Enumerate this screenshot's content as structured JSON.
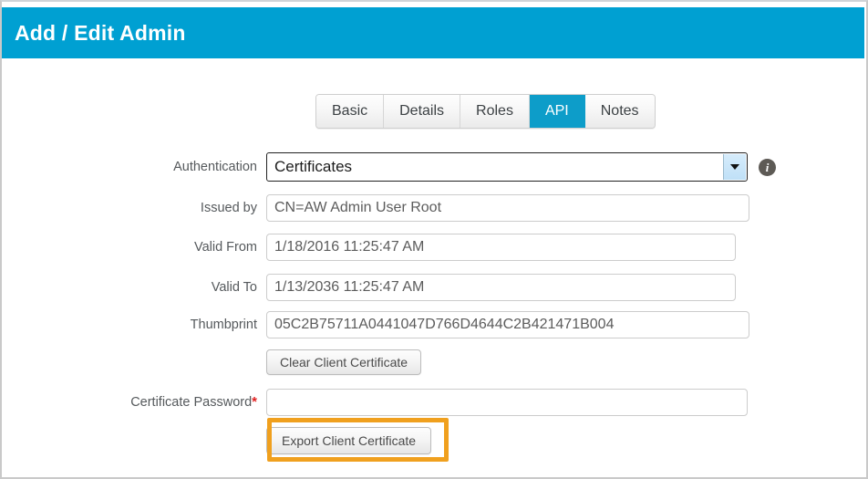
{
  "header": {
    "title": "Add / Edit Admin",
    "bg_color": "#00a0d2"
  },
  "tabs": [
    {
      "label": "Basic",
      "active": false
    },
    {
      "label": "Details",
      "active": false
    },
    {
      "label": "Roles",
      "active": false
    },
    {
      "label": "API",
      "active": true
    },
    {
      "label": "Notes",
      "active": false
    }
  ],
  "form": {
    "authentication": {
      "label": "Authentication",
      "value": "Certificates",
      "info_icon": "info-icon"
    },
    "issued_by": {
      "label": "Issued by",
      "value": "CN=AW Admin User Root"
    },
    "valid_from": {
      "label": "Valid From",
      "value": "1/18/2016 11:25:47 AM"
    },
    "valid_to": {
      "label": "Valid To",
      "value": "1/13/2036 11:25:47 AM"
    },
    "thumbprint": {
      "label": "Thumbprint",
      "value": "05C2B75711A0441047D766D4644C2B421471B004"
    },
    "clear_button": {
      "label": "Clear Client Certificate"
    },
    "certificate_password": {
      "label": "Certificate Password",
      "required_marker": "*",
      "value": "",
      "placeholder": ""
    },
    "export_button": {
      "label": "Export Client Certificate"
    }
  },
  "annotation": {
    "highlight_color": "#f0a01e",
    "target": "export-client-certificate-button"
  }
}
